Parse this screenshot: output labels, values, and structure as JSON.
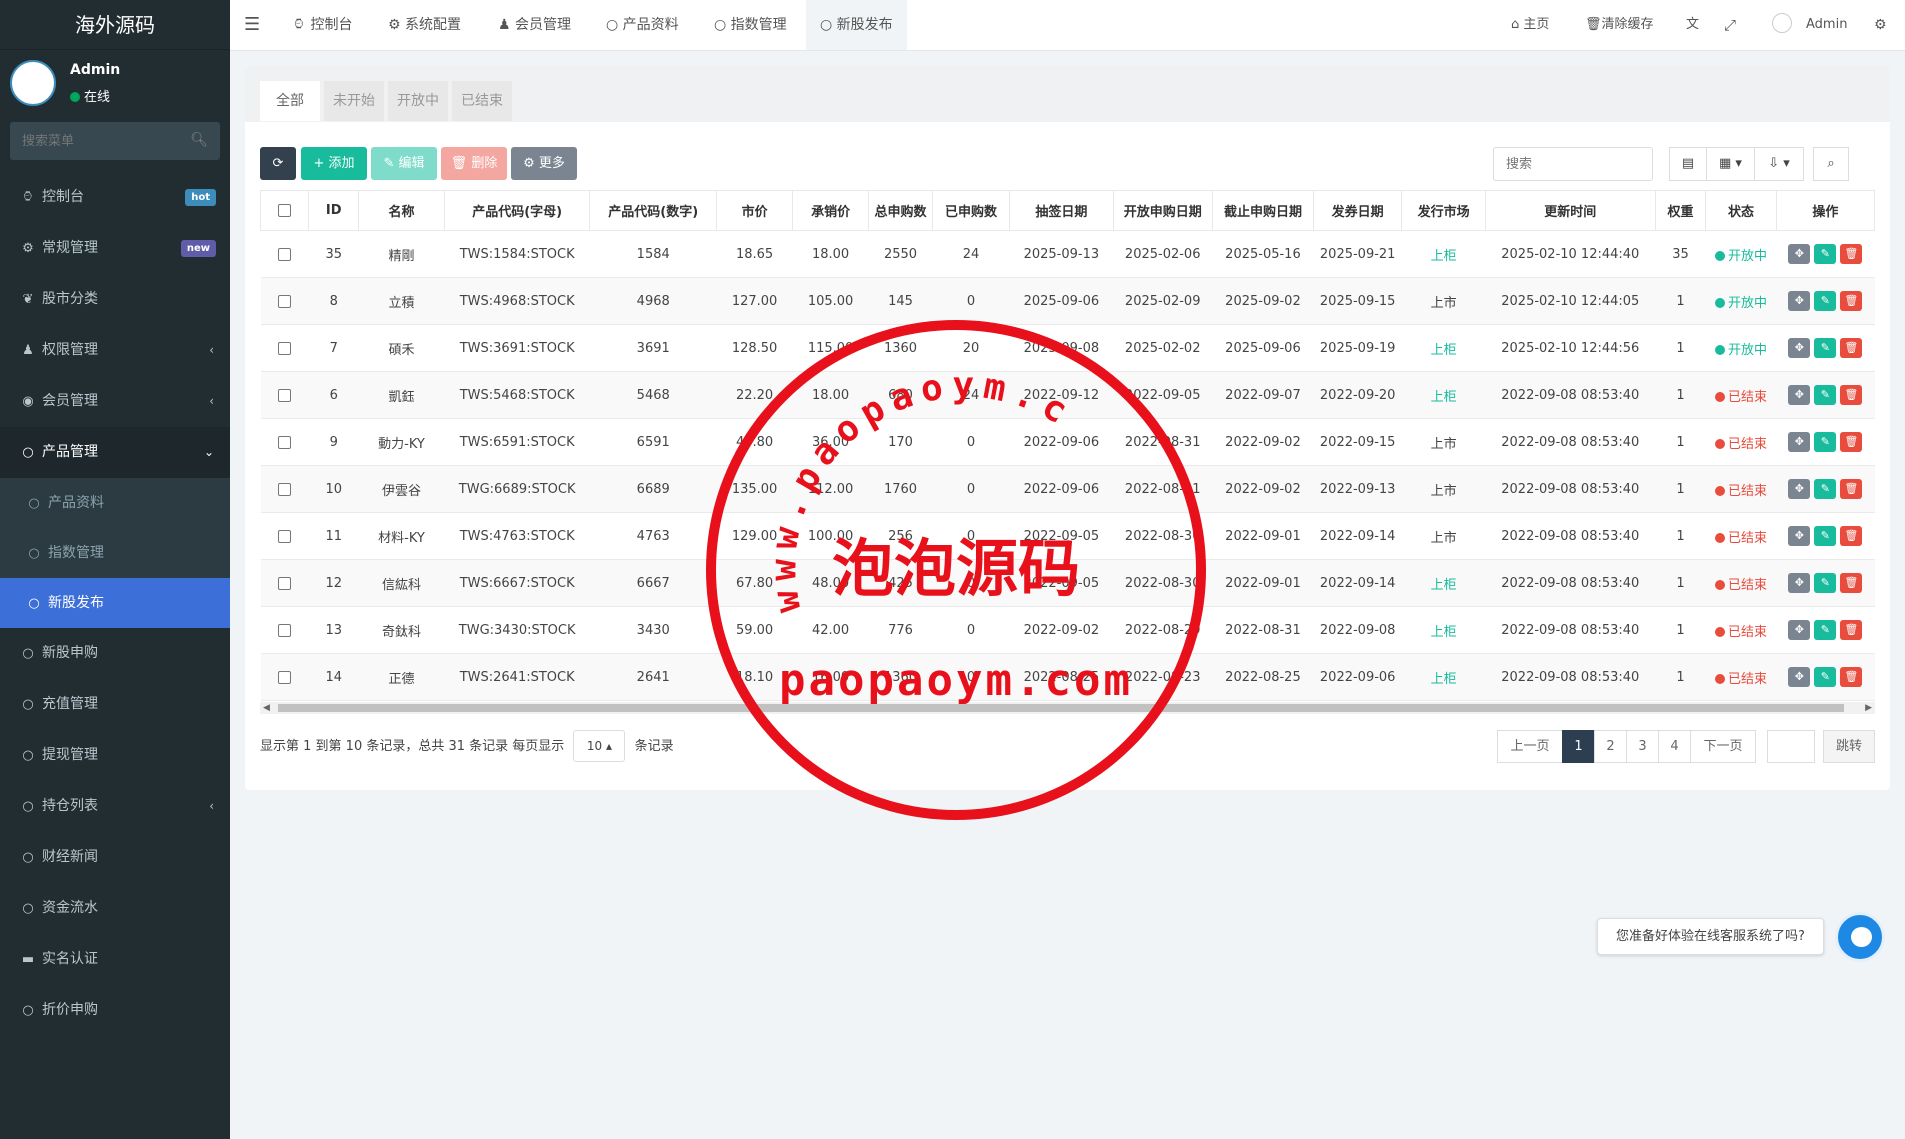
{
  "sidebar": {
    "logo": "海外源码",
    "user": {
      "name": "Admin",
      "status": "在线"
    },
    "search_placeholder": "搜索菜单",
    "items": [
      {
        "label": "控制台",
        "icon": "dashboard-icon",
        "badge": "hot",
        "badge_color": "#3c8dbc"
      },
      {
        "label": "常规管理",
        "icon": "cogs-icon",
        "badge": "new",
        "badge_color": "#605ca8"
      },
      {
        "label": "股市分类",
        "icon": "leaf-icon"
      },
      {
        "label": "权限管理",
        "icon": "group-icon",
        "arrow": "‹"
      },
      {
        "label": "会员管理",
        "icon": "user-circle-icon",
        "arrow": "‹"
      },
      {
        "label": "产品管理",
        "icon": "circle-icon",
        "arrow": "⌄"
      },
      {
        "label": "产品资料",
        "icon": "circle-icon"
      },
      {
        "label": "指数管理",
        "icon": "circle-icon"
      },
      {
        "label": "新股发布",
        "icon": "circle-icon"
      },
      {
        "label": "新股申购",
        "icon": "circle-icon"
      },
      {
        "label": "充值管理",
        "icon": "circle-icon"
      },
      {
        "label": "提现管理",
        "icon": "circle-icon"
      },
      {
        "label": "持仓列表",
        "icon": "circle-icon",
        "arrow": "‹"
      },
      {
        "label": "财经新闻",
        "icon": "circle-icon"
      },
      {
        "label": "资金流水",
        "icon": "circle-icon"
      },
      {
        "label": "实名认证",
        "icon": "credit-card-icon"
      },
      {
        "label": "折价申购",
        "icon": "circle-icon"
      }
    ]
  },
  "topbar": {
    "menu_icon": "hamburger-icon",
    "tabs": [
      {
        "label": "控制台",
        "icon": "dashboard-icon"
      },
      {
        "label": "系统配置",
        "icon": "gear-icon"
      },
      {
        "label": "会员管理",
        "icon": "user-icon"
      },
      {
        "label": "产品资料",
        "icon": "circle-icon"
      },
      {
        "label": "指数管理",
        "icon": "circle-icon"
      },
      {
        "label": "新股发布",
        "icon": "circle-icon"
      }
    ],
    "right": {
      "home": "主页",
      "clear_cache": "清除缓存",
      "user": "Admin"
    }
  },
  "filter_tabs": [
    "全部",
    "未开始",
    "开放中",
    "已结束"
  ],
  "toolbar": {
    "add": "添加",
    "edit": "编辑",
    "delete": "删除",
    "more": "更多",
    "search_placeholder": "搜索"
  },
  "table": {
    "headers": [
      "ID",
      "名称",
      "产品代码(字母)",
      "产品代码(数字)",
      "市价",
      "承销价",
      "总申购数",
      "已申购数",
      "抽签日期",
      "开放申购日期",
      "截止申购日期",
      "发券日期",
      "发行市场",
      "更新时间",
      "权重",
      "状态",
      "操作"
    ],
    "rows": [
      {
        "id": "35",
        "name": "精剛",
        "code": "TWS:1584:STOCK",
        "num": "1584",
        "price": "18.65",
        "under": "18.00",
        "total": "2550",
        "applied": "24",
        "draw": "2025-09-13",
        "open": "2025-02-06",
        "close": "2025-05-16",
        "issue": "2025-09-21",
        "market": "上柜",
        "market_link": true,
        "updated": "2025-02-10 12:44:40",
        "weight": "35",
        "status": "开放中",
        "status_type": "open"
      },
      {
        "id": "8",
        "name": "立積",
        "code": "TWS:4968:STOCK",
        "num": "4968",
        "price": "127.00",
        "under": "105.00",
        "total": "145",
        "applied": "0",
        "draw": "2025-09-06",
        "open": "2025-02-09",
        "close": "2025-09-02",
        "issue": "2025-09-15",
        "market": "上市",
        "market_link": false,
        "updated": "2025-02-10 12:44:05",
        "weight": "1",
        "status": "开放中",
        "status_type": "open"
      },
      {
        "id": "7",
        "name": "碩禾",
        "code": "TWS:3691:STOCK",
        "num": "3691",
        "price": "128.50",
        "under": "115.00",
        "total": "1360",
        "applied": "20",
        "draw": "2025-09-08",
        "open": "2025-02-02",
        "close": "2025-09-06",
        "issue": "2025-09-19",
        "market": "上柜",
        "market_link": true,
        "updated": "2025-02-10 12:44:56",
        "weight": "1",
        "status": "开放中",
        "status_type": "open"
      },
      {
        "id": "6",
        "name": "凱鈺",
        "code": "TWS:5468:STOCK",
        "num": "5468",
        "price": "22.20",
        "under": "18.00",
        "total": "680",
        "applied": "24",
        "draw": "2022-09-12",
        "open": "2022-09-05",
        "close": "2022-09-07",
        "issue": "2022-09-20",
        "market": "上柜",
        "market_link": true,
        "updated": "2022-09-08 08:53:40",
        "weight": "1",
        "status": "已结束",
        "status_type": "end"
      },
      {
        "id": "9",
        "name": "動力-KY",
        "code": "TWS:6591:STOCK",
        "num": "6591",
        "price": "44.80",
        "under": "36.00",
        "total": "170",
        "applied": "0",
        "draw": "2022-09-06",
        "open": "2022-08-31",
        "close": "2022-09-02",
        "issue": "2022-09-15",
        "market": "上市",
        "market_link": false,
        "updated": "2022-09-08 08:53:40",
        "weight": "1",
        "status": "已结束",
        "status_type": "end"
      },
      {
        "id": "10",
        "name": "伊雲谷",
        "code": "TWG:6689:STOCK",
        "num": "6689",
        "price": "135.00",
        "under": "112.00",
        "total": "1760",
        "applied": "0",
        "draw": "2022-09-06",
        "open": "2022-08-31",
        "close": "2022-09-02",
        "issue": "2022-09-13",
        "market": "上市",
        "market_link": false,
        "updated": "2022-09-08 08:53:40",
        "weight": "1",
        "status": "已结束",
        "status_type": "end"
      },
      {
        "id": "11",
        "name": "材料-KY",
        "code": "TWS:4763:STOCK",
        "num": "4763",
        "price": "129.00",
        "under": "100.00",
        "total": "256",
        "applied": "0",
        "draw": "2022-09-05",
        "open": "2022-08-30",
        "close": "2022-09-01",
        "issue": "2022-09-14",
        "market": "上市",
        "market_link": false,
        "updated": "2022-09-08 08:53:40",
        "weight": "1",
        "status": "已结束",
        "status_type": "end"
      },
      {
        "id": "12",
        "name": "信紘科",
        "code": "TWS:6667:STOCK",
        "num": "6667",
        "price": "67.80",
        "under": "48.00",
        "total": "425",
        "applied": "0",
        "draw": "2022-09-05",
        "open": "2022-08-30",
        "close": "2022-09-01",
        "issue": "2022-09-14",
        "market": "上柜",
        "market_link": true,
        "updated": "2022-09-08 08:53:40",
        "weight": "1",
        "status": "已结束",
        "status_type": "end"
      },
      {
        "id": "13",
        "name": "奇鈦科",
        "code": "TWG:3430:STOCK",
        "num": "3430",
        "price": "59.00",
        "under": "42.00",
        "total": "776",
        "applied": "0",
        "draw": "2022-09-02",
        "open": "2022-08-29",
        "close": "2022-08-31",
        "issue": "2022-09-08",
        "market": "上柜",
        "market_link": true,
        "updated": "2022-09-08 08:53:40",
        "weight": "1",
        "status": "已结束",
        "status_type": "end"
      },
      {
        "id": "14",
        "name": "正德",
        "code": "TWS:2641:STOCK",
        "num": "2641",
        "price": "18.10",
        "under": "16.00",
        "total": "1360",
        "applied": "0",
        "draw": "2022-08-25",
        "open": "2022-08-23",
        "close": "2022-08-25",
        "issue": "2022-09-06",
        "market": "上柜",
        "market_link": true,
        "updated": "2022-09-08 08:53:40",
        "weight": "1",
        "status": "已结束",
        "status_type": "end"
      }
    ]
  },
  "pagination": {
    "info_prefix": "显示第 1 到第 10 条记录，总共 31 条记录 每页显示",
    "page_size": "10",
    "info_suffix": "条记录",
    "prev": "上一页",
    "pages": [
      "1",
      "2",
      "3",
      "4"
    ],
    "next": "下一页",
    "jump": "跳转"
  },
  "chat": {
    "text": "您准备好体验在线客服系统了吗?"
  },
  "watermark": {
    "url_top": "www.paopaoym.com",
    "center": "泡泡源码",
    "bottom": "paopaoym.com",
    "color": "#e8101a"
  },
  "colors": {
    "accent": "#3c6fd8",
    "green": "#18bc9c",
    "red": "#e74c3c"
  }
}
